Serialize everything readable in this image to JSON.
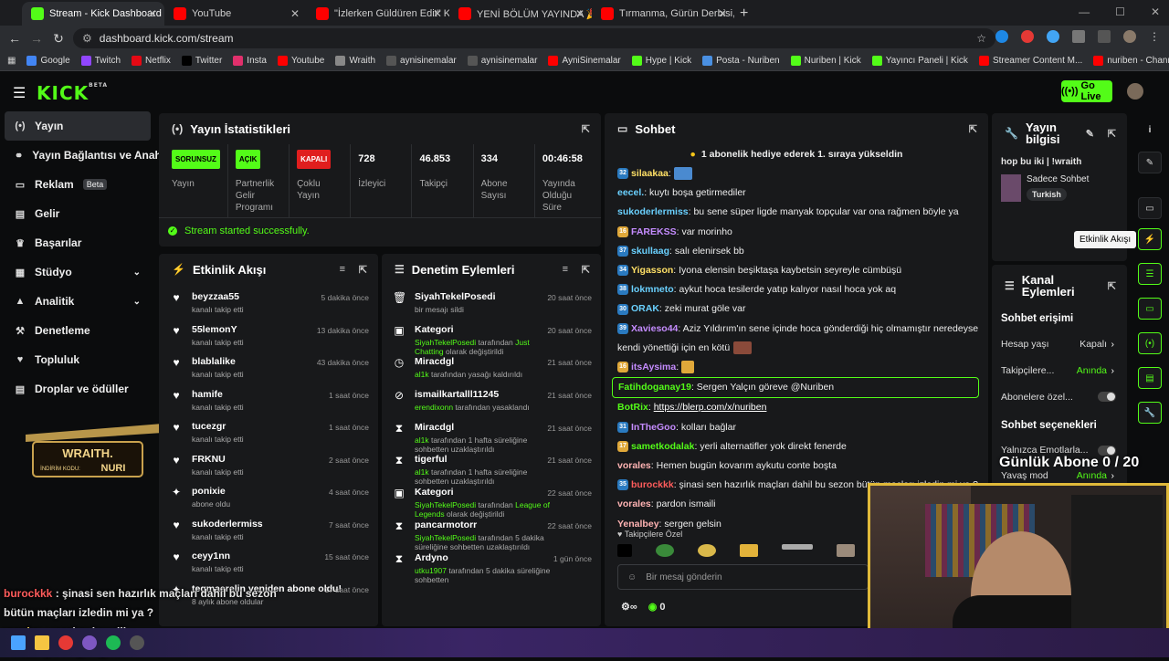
{
  "browser": {
    "tabs": [
      {
        "title": "Stream - Kick Dashboard",
        "color": "#53fc18"
      },
      {
        "title": "YouTube",
        "color": "#ff0000"
      },
      {
        "title": "\"İzlerken Güldüren Edit\" Kick &",
        "color": "#ff0000"
      },
      {
        "title": "YENİ BÖLÜM YAYINDA 🎉 @O",
        "color": "#ff0000"
      },
      {
        "title": "Tırmanma, Gürün Derbisi, Yükse",
        "color": "#ff0000"
      }
    ],
    "url": "dashboard.kick.com/stream",
    "bookmarks": [
      "Google",
      "Twitch",
      "Netflix",
      "Twitter",
      "Insta",
      "Youtube",
      "Wraith",
      "aynisinemalar",
      "aynisinemalar",
      "AyniSinemalar",
      "Hype | Kick",
      "Posta - Nuriben",
      "Nuriben | Kick",
      "Yayıncı Paneli | Kick",
      "Streamer Content M...",
      "nuriben - Channel S...",
      "Aynı Sinemalar - Ça..."
    ]
  },
  "header": {
    "logo": "KICK",
    "logo_sup": "BETA",
    "go_live": "Go Live"
  },
  "sidebar": {
    "items": [
      {
        "label": "Yayın",
        "icon": "broadcast-icon"
      },
      {
        "label": "Yayın Bağlantısı ve Anahtar",
        "icon": "link-icon"
      },
      {
        "label": "Reklam",
        "icon": "ad-icon",
        "badge": "Beta"
      },
      {
        "label": "Gelir",
        "icon": "money-icon"
      },
      {
        "label": "Başarılar",
        "icon": "trophy-icon"
      },
      {
        "label": "Stüdyo",
        "icon": "studio-icon"
      },
      {
        "label": "Analitik",
        "icon": "analytics-icon"
      },
      {
        "label": "Denetleme",
        "icon": "hammer-icon"
      },
      {
        "label": "Topluluk",
        "icon": "heart-icon"
      },
      {
        "label": "Droplar ve ödüller",
        "icon": "gift-icon"
      }
    ],
    "promo": {
      "brand": "WRAITH.",
      "text": "İNDİRİM KODU:",
      "code": "NURI"
    }
  },
  "stats": {
    "title": "Yayın İstatistikleri",
    "cells": [
      {
        "badge": "SORUNSUZ",
        "badge_color": "#53fc18",
        "label": "Yayın"
      },
      {
        "badge": "AÇIK",
        "badge_color": "#53fc18",
        "label": "Partnerlik Gelir Programı"
      },
      {
        "badge": "KAPALI",
        "badge_color": "#e01e1e",
        "label": "Çoklu Yayın"
      },
      {
        "value": "728",
        "label": "İzleyici"
      },
      {
        "value": "46.853",
        "label": "Takipçi"
      },
      {
        "value": "334",
        "label": "Abone Sayısı"
      },
      {
        "value": "00:46:58",
        "label": "Yayında Olduğu Süre"
      }
    ],
    "status": "Stream started successfully."
  },
  "activity": {
    "title": "Etkinlik Akışı",
    "items": [
      {
        "name": "beyzzaa55",
        "sub": "kanalı takip etti",
        "time": "5 dakika önce",
        "icon": "heart-icon"
      },
      {
        "name": "55lemonY",
        "sub": "kanalı takip etti",
        "time": "13 dakika önce",
        "icon": "heart-icon"
      },
      {
        "name": "blablalike",
        "sub": "kanalı takip etti",
        "time": "43 dakika önce",
        "icon": "heart-icon"
      },
      {
        "name": "hamife",
        "sub": "kanalı takip etti",
        "time": "1 saat önce",
        "icon": "heart-icon"
      },
      {
        "name": "tucezgr",
        "sub": "kanalı takip etti",
        "time": "1 saat önce",
        "icon": "heart-icon"
      },
      {
        "name": "FRKNU",
        "sub": "kanalı takip etti",
        "time": "2 saat önce",
        "icon": "heart-icon"
      },
      {
        "name": "ponixie",
        "sub": "abone oldu",
        "time": "4 saat önce",
        "icon": "sparkle-icon"
      },
      {
        "name": "sukoderlermiss",
        "sub": "kanalı takip etti",
        "time": "7 saat önce",
        "icon": "heart-icon"
      },
      {
        "name": "ceyy1nn",
        "sub": "kanalı takip etti",
        "time": "15 saat önce",
        "icon": "heart-icon"
      },
      {
        "name": "tegmaerelin yeniden abone oldu!",
        "sub": "8 aylık abone oldular",
        "time": "17 saat önce",
        "icon": "sparkle-icon"
      }
    ]
  },
  "moderation": {
    "title": "Denetim Eylemleri",
    "items": [
      {
        "name": "SiyahTekelPosedi",
        "pre": "",
        "sub": "bir mesajı sildi",
        "time": "20 saat önce",
        "icon": "trash-icon"
      },
      {
        "name": "Kategori",
        "pre": "SiyahTekelPosedi",
        "sub": " tarafından ",
        "post": "Just Chatting",
        "tail": " olarak değiştirildi",
        "time": "20 saat önce",
        "icon": "category-icon"
      },
      {
        "name": "Miracdgl",
        "pre": "al1k",
        "sub": " tarafından yasağı kaldırıldı",
        "time": "21 saat önce",
        "icon": "clock-icon"
      },
      {
        "name": "ismailkartalll11245",
        "pre": "erendixonn",
        "sub": " tarafından yasaklandı",
        "time": "21 saat önce",
        "icon": "ban-icon"
      },
      {
        "name": "Miracdgl",
        "pre": "al1k",
        "sub": " tarafından 1 hafta süreliğine sohbetten uzaklaştırıldı",
        "time": "21 saat önce",
        "icon": "hourglass-icon"
      },
      {
        "name": "tigerful",
        "pre": "al1k",
        "sub": " tarafından 1 hafta süreliğine sohbetten uzaklaştırıldı",
        "time": "21 saat önce",
        "icon": "hourglass-icon"
      },
      {
        "name": "Kategori",
        "pre": "SiyahTekelPosedi",
        "sub": " tarafından ",
        "post": "League of Legends",
        "tail": " olarak değiştirildi",
        "time": "22 saat önce",
        "icon": "category-icon"
      },
      {
        "name": "pancarmotorr",
        "pre": "SiyahTekelPosedi",
        "sub": " tarafından 5 dakika süreliğine sohbetten uzaklaştırıldı",
        "time": "22 saat önce",
        "icon": "hourglass-icon"
      },
      {
        "name": "Ardyno",
        "pre": "utku1907",
        "sub": " tarafından 5 dakika süreliğine sohbetten",
        "time": "1 gün önce",
        "icon": "hourglass-icon"
      }
    ]
  },
  "chat": {
    "title": "Sohbet",
    "pinned": "1 abonelik hediye ederek 1. sıraya yükseldin",
    "messages": [
      {
        "badge": "32",
        "user": "silaakaa",
        "color": "#ffe066",
        "text": ""
      },
      {
        "badge": "",
        "user": "eecel.",
        "color": "#6ad1ff",
        "text": "kuytı boşa getirmediler"
      },
      {
        "badge": "",
        "user": "sukoderlermiss",
        "color": "#6ad1ff",
        "text": "bu sene süper ligde manyak topçular var ona rağmen böyle ya"
      },
      {
        "badge": "16",
        "user": "FAREKSS",
        "color": "#c58cff",
        "text": "var morinho"
      },
      {
        "badge": "37",
        "user": "skullaag",
        "color": "#6ad1ff",
        "text": "salı elenirsek bb"
      },
      {
        "badge": "34",
        "user": "Yigasson",
        "color": "#ffe066",
        "text": "Iyona elensin beşiktaşa kaybetsin seyreyle cümbüşü"
      },
      {
        "badge": "38",
        "user": "lokmneto",
        "color": "#6ad1ff",
        "text": "aykut hoca tesilerde yatıp kalıyor nasıl hoca yok aq"
      },
      {
        "badge": "30",
        "user": "ORAK",
        "color": "#6ad1ff",
        "text": "zeki murat göle var"
      },
      {
        "badge": "39",
        "user": "Xavieso44",
        "color": "#c58cff",
        "text": "Aziz Yıldırım'ın sene içinde hoca gönderdiği hiç olmamıştır neredeyse"
      },
      {
        "badge": "",
        "user": "",
        "color": "#eee",
        "text": "kendi yönettiği için en kötü"
      },
      {
        "badge": "16",
        "user": "itsAysima",
        "color": "#c58cff",
        "text": ""
      },
      {
        "badge": "",
        "user": "Fatihdoganay19",
        "color": "#53fc18",
        "text": "Sergen Yalçın göreve @Nuriben",
        "highlight": true
      },
      {
        "badge": "",
        "user": "BotRix",
        "color": "#53fc18",
        "text": "https://blerp.com/x/nuriben"
      },
      {
        "badge": "31",
        "user": "InTheGoo",
        "color": "#c58cff",
        "text": "kolları bağlar"
      },
      {
        "badge": "17",
        "user": "sametkodalak",
        "color": "#53fc18",
        "text": "yerli alternatifler yok direkt fenerde"
      },
      {
        "badge": "",
        "user": "vorales",
        "color": "#ffb3b3",
        "text": "Hemen bugün kovarım aykutu conte boşta"
      },
      {
        "badge": "35",
        "user": "burockkk",
        "color": "#ff5c5c",
        "text": "şinasi sen hazırlık maçları dahil bu sezon bütün maçları izledin mi ya ?"
      },
      {
        "badge": "",
        "user": "vorales",
        "color": "#ffb3b3",
        "text": "pardon ismaili"
      },
      {
        "badge": "",
        "user": "Yenalbey",
        "color": "#ffb3b3",
        "text": "sergen gelsin"
      }
    ],
    "emote_row_label": "Takipçilere Özel",
    "input_placeholder": "Bir mesaj gönderin",
    "points": "0"
  },
  "stream_info": {
    "title": "Yayın bilgisi",
    "stream_title": "hop bu iki | !wraith",
    "category": "Sadece Sohbet",
    "tag": "Turkish",
    "tooltip": "Etkinlik Akışı"
  },
  "channel_actions": {
    "title": "Kanal Eylemleri",
    "chat_access": "Sohbet erişimi",
    "rows": [
      {
        "label": "Hesap yaşı",
        "value": "Kapalı"
      },
      {
        "label": "Takipçilere...",
        "value": "Anında"
      },
      {
        "label": "Abonelere özel...",
        "value": ""
      }
    ],
    "chat_options": "Sohbet seçenekleri",
    "opt_rows": [
      {
        "label": "Yalnızca Emotlarla...",
        "value": ""
      },
      {
        "label": "Yavaş mod",
        "value": "Anında"
      }
    ]
  },
  "overlay": {
    "goal": "Günlük Abone 0 / 20",
    "chat": [
      {
        "user": "burockkk",
        "color": "#ff5c5c",
        "text": "şinasi sen hazırlık maçları dahil bu sezon"
      },
      {
        "user": "",
        "color": "#fff",
        "text": "bütün maçları izledin mi ya ?"
      },
      {
        "user": "vorales",
        "color": "#ffe066",
        "text": "pardon ismaili"
      },
      {
        "user": "Yenalbey",
        "color": "#ffe066",
        "text": "sergen gelsin"
      }
    ]
  }
}
